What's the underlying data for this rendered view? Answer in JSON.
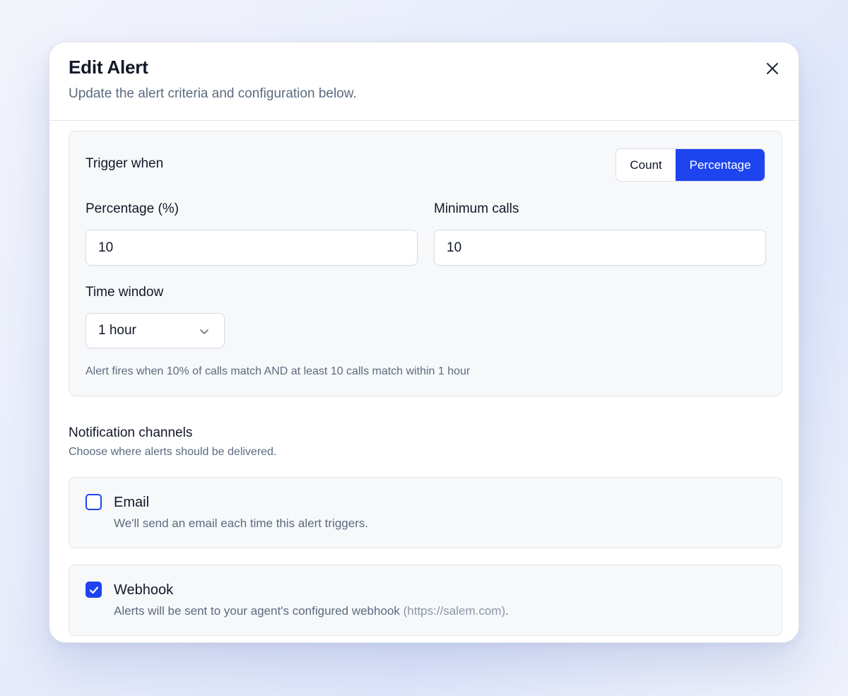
{
  "header": {
    "title": "Edit Alert",
    "subtitle": "Update the alert criteria and configuration below."
  },
  "icons": {
    "close": "close-icon",
    "chevron": "chevron-down-icon",
    "check": "check-icon"
  },
  "trigger": {
    "label": "Trigger when",
    "modes": [
      {
        "label": "Count",
        "selected": false
      },
      {
        "label": "Percentage",
        "selected": true
      }
    ],
    "percentage_label": "Percentage (%)",
    "percentage_value": "10",
    "min_calls_label": "Minimum calls",
    "min_calls_value": "10",
    "time_window_label": "Time window",
    "time_window_value": "1 hour",
    "helper": "Alert fires when 10% of calls match AND at least 10 calls match within 1 hour"
  },
  "notifications": {
    "title": "Notification channels",
    "description": "Choose where alerts should be delivered.",
    "channels": [
      {
        "title": "Email",
        "description": "We'll send an email each time this alert triggers.",
        "checked": false
      },
      {
        "title": "Webhook",
        "description_prefix": "Alerts will be sent to your agent's configured webhook",
        "url": "(https://salem.com)",
        "description_suffix": ".",
        "checked": true
      }
    ]
  },
  "colors": {
    "accent": "#1e44f0",
    "text_primary": "#111827",
    "text_secondary": "#5b6b7f",
    "card_bg": "#f7f8fa"
  }
}
